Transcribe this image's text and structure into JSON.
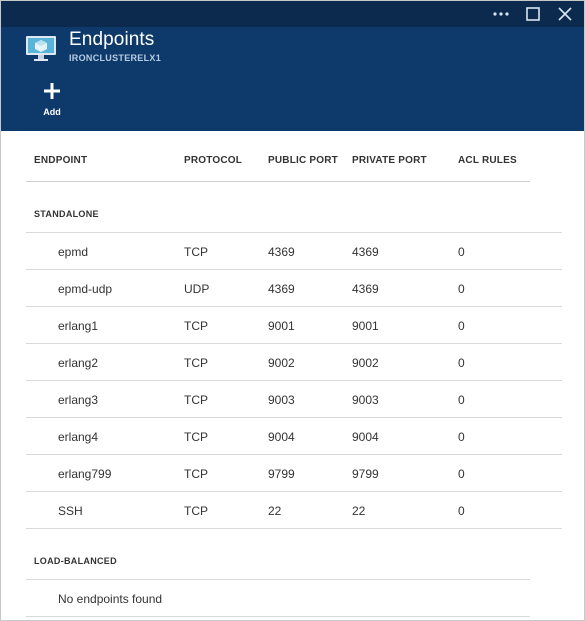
{
  "window": {
    "more_icon": "ellipsis-icon",
    "maximize_icon": "maximize-icon",
    "close_icon": "close-icon"
  },
  "header": {
    "title": "Endpoints",
    "subtitle": "IRONCLUSTERELX1",
    "icon": "virtual-machine-icon",
    "bg_color": "#0e3a6b",
    "titlebar_color": "#0b2a4e"
  },
  "commands": {
    "add_label": "Add",
    "add_icon": "plus-icon"
  },
  "table": {
    "columns": [
      "ENDPOINT",
      "PROTOCOL",
      "PUBLIC PORT",
      "PRIVATE PORT",
      "ACL RULES"
    ],
    "sections": [
      {
        "label": "STANDALONE",
        "rows": [
          {
            "endpoint": "epmd",
            "protocol": "TCP",
            "public_port": "4369",
            "private_port": "4369",
            "acl_rules": "0"
          },
          {
            "endpoint": "epmd-udp",
            "protocol": "UDP",
            "public_port": "4369",
            "private_port": "4369",
            "acl_rules": "0"
          },
          {
            "endpoint": "erlang1",
            "protocol": "TCP",
            "public_port": "9001",
            "private_port": "9001",
            "acl_rules": "0"
          },
          {
            "endpoint": "erlang2",
            "protocol": "TCP",
            "public_port": "9002",
            "private_port": "9002",
            "acl_rules": "0"
          },
          {
            "endpoint": "erlang3",
            "protocol": "TCP",
            "public_port": "9003",
            "private_port": "9003",
            "acl_rules": "0"
          },
          {
            "endpoint": "erlang4",
            "protocol": "TCP",
            "public_port": "9004",
            "private_port": "9004",
            "acl_rules": "0"
          },
          {
            "endpoint": "erlang799",
            "protocol": "TCP",
            "public_port": "9799",
            "private_port": "9799",
            "acl_rules": "0"
          },
          {
            "endpoint": "SSH",
            "protocol": "TCP",
            "public_port": "22",
            "private_port": "22",
            "acl_rules": "0"
          }
        ]
      },
      {
        "label": "LOAD-BALANCED",
        "empty_text": "No endpoints found"
      }
    ]
  }
}
